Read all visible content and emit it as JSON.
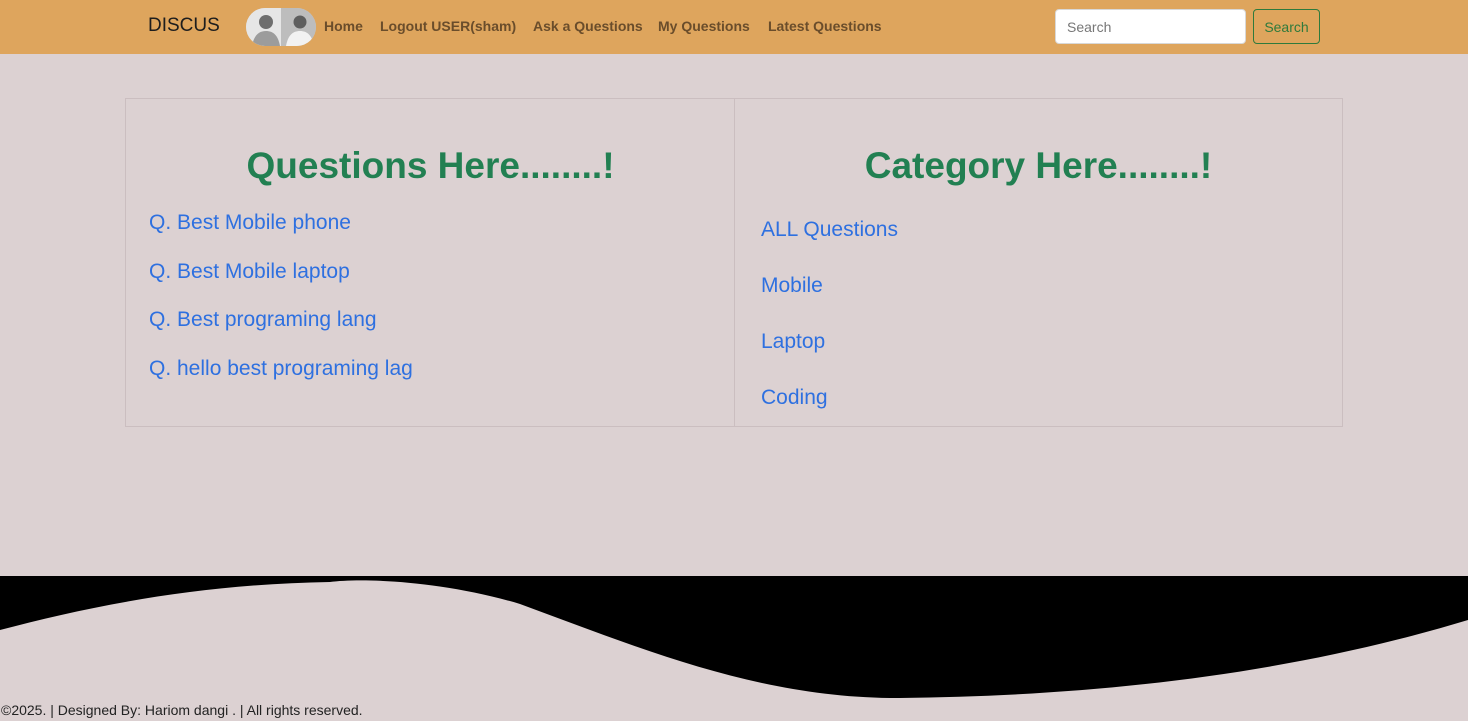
{
  "navbar": {
    "brand": "DISCUS",
    "links": [
      "Home",
      "Logout USER(sham)",
      "Ask a Questions",
      "My Questions",
      "Latest Questions"
    ],
    "search_placeholder": "Search",
    "search_button": "Search",
    "background": "#dea55d"
  },
  "questions_panel": {
    "title": "Questions Here........!",
    "items": [
      "Q. Best Mobile phone",
      "Q. Best Mobile laptop",
      "Q. Best programing lang",
      "Q. hello best programing lag"
    ]
  },
  "category_panel": {
    "title": "Category Here........!",
    "items": [
      "ALL Questions",
      "Mobile",
      "Laptop",
      "Coding"
    ]
  },
  "footer": {
    "text": "©2025. | Designed By: Hariom dangi . | All rights reserved."
  },
  "colors": {
    "page_background": "#dcd1d2",
    "heading_green": "#228052",
    "link_blue": "#2e70e0",
    "wave": "#000000"
  }
}
